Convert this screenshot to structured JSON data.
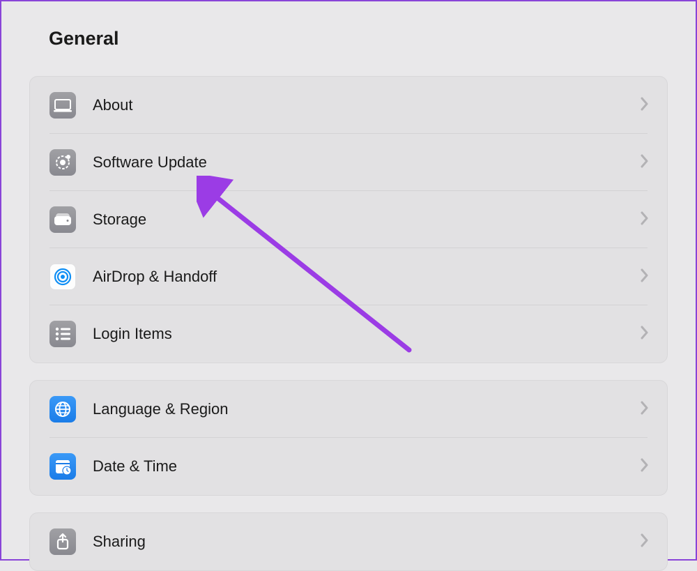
{
  "header": {
    "title": "General"
  },
  "sections": [
    {
      "items": [
        {
          "label": "About",
          "icon": "about"
        },
        {
          "label": "Software Update",
          "icon": "software-update"
        },
        {
          "label": "Storage",
          "icon": "storage"
        },
        {
          "label": "AirDrop & Handoff",
          "icon": "airdrop"
        },
        {
          "label": "Login Items",
          "icon": "login-items"
        }
      ]
    },
    {
      "items": [
        {
          "label": "Language & Region",
          "icon": "language"
        },
        {
          "label": "Date & Time",
          "icon": "date-time"
        }
      ]
    },
    {
      "items": [
        {
          "label": "Sharing",
          "icon": "sharing"
        }
      ]
    }
  ],
  "annotation": {
    "type": "arrow",
    "color": "#9b3ce5",
    "target": "software-update"
  }
}
